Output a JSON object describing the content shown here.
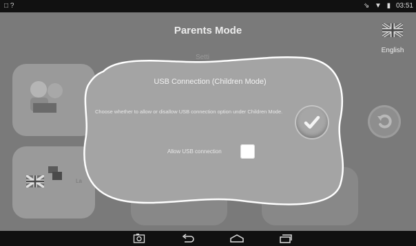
{
  "statusbar": {
    "left_icons": [
      "image-icon",
      "question-icon"
    ],
    "right_icons": [
      "signal-icon",
      "wifi-icon",
      "battery-icon"
    ],
    "time": "03:51"
  },
  "header": {
    "title": "Parents Mode",
    "language": "English",
    "language_icon": "uk-flag-icon"
  },
  "background": {
    "section_label": "Setti"
  },
  "dialog": {
    "title": "USB Connection (Children Mode)",
    "description": "Choose whether to allow or disallow USB connection option under Children Mode.",
    "option_label": "Allow USB connection",
    "option_checked": false,
    "confirm_icon": "checkmark-icon"
  },
  "navbar": {
    "icons": [
      "screenshot-icon",
      "back-icon",
      "home-icon",
      "recent-apps-icon"
    ]
  },
  "colors": {
    "overlay_grey": "#8c8c8c",
    "dialog_fill": "#a4a4a4",
    "dialog_border": "#ffffff",
    "bar_black": "#111111"
  }
}
